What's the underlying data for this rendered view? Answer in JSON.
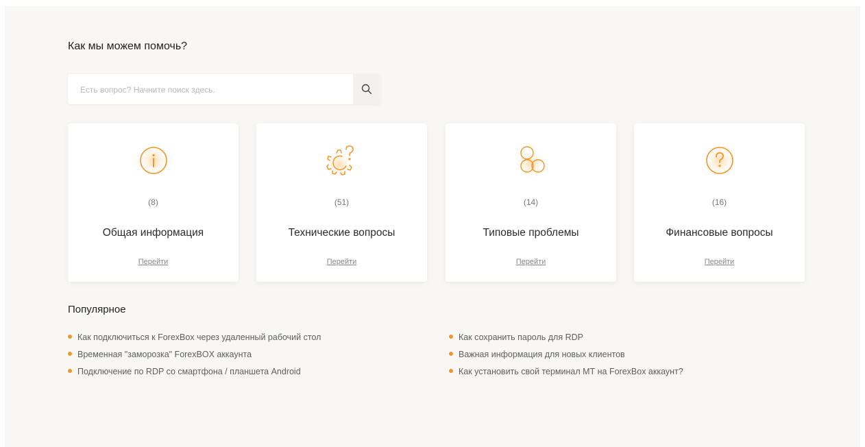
{
  "header": {
    "title": "Как мы можем помочь?"
  },
  "search": {
    "placeholder": "Есть вопрос? Начните поиск здесь."
  },
  "cards": [
    {
      "icon": "info-icon",
      "count": "(8)",
      "title": "Общая информация",
      "link": "Перейти"
    },
    {
      "icon": "gear-question-icon",
      "count": "(51)",
      "title": "Технические вопросы",
      "link": "Перейти"
    },
    {
      "icon": "circles-icon",
      "count": "(14)",
      "title": "Типовые проблемы",
      "link": "Перейти"
    },
    {
      "icon": "question-icon",
      "count": "(16)",
      "title": "Финансовые вопросы",
      "link": "Перейти"
    }
  ],
  "popular": {
    "title": "Популярное",
    "left": [
      "Как подключиться к ForexBox через удаленный рабочий стол",
      "Временная \"заморозка\" ForexBOX аккаунта",
      "Подключение по RDP со смартфона / планшета Android"
    ],
    "right": [
      "Как сохранить пароль для RDP",
      "Важная информация для новых клиентов",
      "Как установить свой терминал МТ на ForexBox аккаунт?"
    ]
  },
  "colors": {
    "accent": "#f0962b",
    "background": "#f8f7f5"
  }
}
